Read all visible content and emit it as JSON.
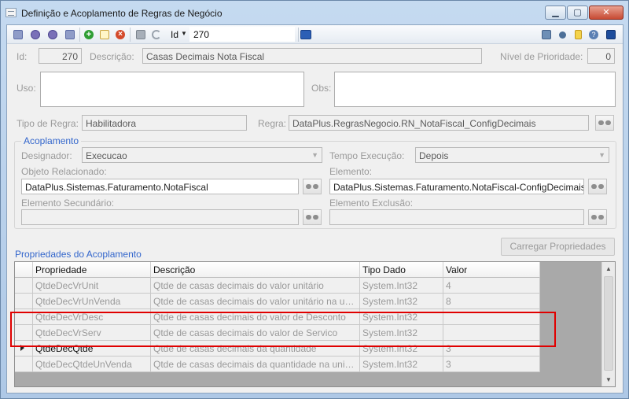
{
  "window": {
    "title": "Definição e Acoplamento de Regras de Negócio"
  },
  "toolbar": {
    "id_label": "Id",
    "id_value": "270",
    "icons": [
      "first-icon",
      "prev-icon",
      "next-icon",
      "last-icon",
      "add-icon",
      "edit-icon",
      "delete-icon",
      "save-icon",
      "undo-icon",
      "go-icon",
      "report-icon",
      "key-icon",
      "note-icon",
      "help-icon",
      "exit-icon"
    ]
  },
  "form": {
    "id_label": "Id:",
    "id_value": "270",
    "descricao_label": "Descrição:",
    "descricao_value": "Casas Decimais Nota Fiscal",
    "prioridade_label": "Nível de Prioridade:",
    "prioridade_value": "0",
    "uso_label": "Uso:",
    "obs_label": "Obs:",
    "tipo_regra_label": "Tipo de Regra:",
    "tipo_regra_value": "Habilitadora",
    "regra_label": "Regra:",
    "regra_value": "DataPlus.RegrasNegocio.RN_NotaFiscal_ConfigDecimais"
  },
  "acoplamento": {
    "title": "Acoplamento",
    "designador_label": "Designador:",
    "designador_value": "Execucao",
    "tempo_label": "Tempo Execução:",
    "tempo_value": "Depois",
    "objeto_label": "Objeto Relacionado:",
    "objeto_value": "DataPlus.Sistemas.Faturamento.NotaFiscal",
    "elemento_label": "Elemento:",
    "elemento_value": "DataPlus.Sistemas.Faturamento.NotaFiscal-ConfigDecimais",
    "elemento_sec_label": "Elemento Secundário:",
    "elemento_exc_label": "Elemento Exclusão:"
  },
  "propriedades": {
    "title": "Propriedades do Acoplamento",
    "load_button": "Carregar Propriedades",
    "columns": [
      "Propriedade",
      "Descrição",
      "Tipo Dado",
      "Valor"
    ],
    "rows": [
      {
        "prop": "QtdeDecVrUnit",
        "desc": "Qtde de casas decimais do valor unitário",
        "tipo": "System.Int32",
        "valor": "4"
      },
      {
        "prop": "QtdeDecVrUnVenda",
        "desc": "Qtde de casas decimais do valor unitário na uni...",
        "tipo": "System.Int32",
        "valor": "8"
      },
      {
        "prop": "QtdeDecVrDesc",
        "desc": "Qtde de casas decimais do valor de Desconto",
        "tipo": "System.Int32",
        "valor": ""
      },
      {
        "prop": "QtdeDecVrServ",
        "desc": "Qtde de casas decimais do valor de Servico",
        "tipo": "System.Int32",
        "valor": ""
      },
      {
        "prop": "QtdeDecQtde",
        "desc": "Qtde de casas decimais da quantidade",
        "tipo": "System.Int32",
        "valor": "3"
      },
      {
        "prop": "QtdeDecQtdeUnVenda",
        "desc": "Qtde de casas decimais da quantidade na unid...",
        "tipo": "System.Int32",
        "valor": "3"
      }
    ]
  },
  "colors": {
    "accent": "#3366cc",
    "highlight": "#e00000"
  }
}
